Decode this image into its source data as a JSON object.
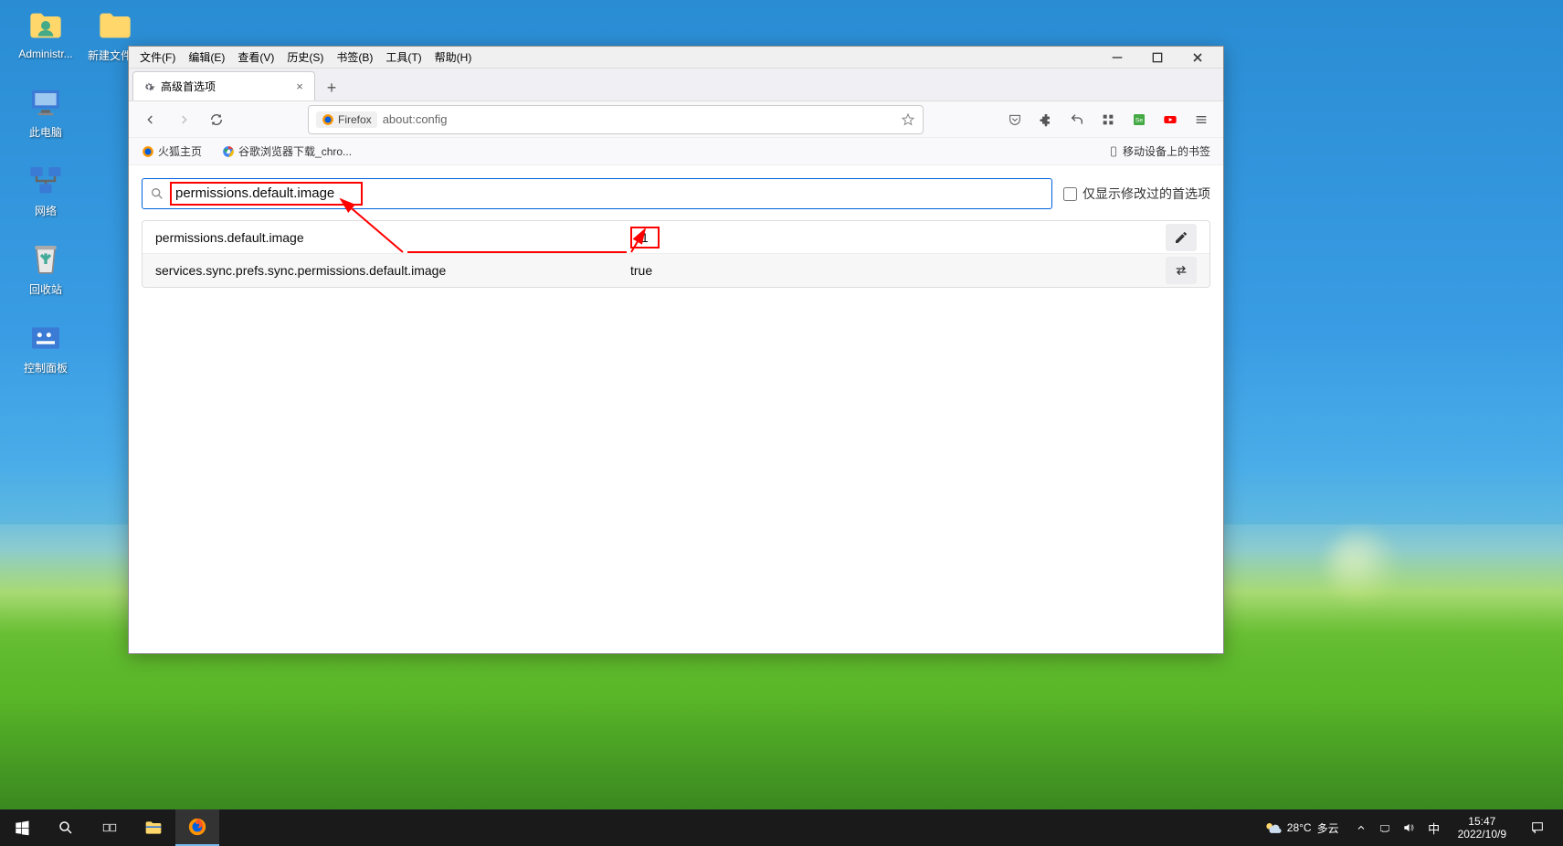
{
  "desktop_icons": {
    "admin": "Administr...",
    "newfolder": "新建文件夹",
    "thispc": "此电脑",
    "network": "网络",
    "recycle": "回收站",
    "control": "控制面板"
  },
  "menubar": {
    "file": "文件(F)",
    "edit": "编辑(E)",
    "view": "查看(V)",
    "history": "历史(S)",
    "bookmarks": "书签(B)",
    "tools": "工具(T)",
    "help": "帮助(H)"
  },
  "tab": {
    "title": "高级首选项"
  },
  "urlbar": {
    "identity": "Firefox",
    "url": "about:config"
  },
  "bookmarks": {
    "firefox_home": "火狐主页",
    "chrome_dl": "谷歌浏览器下载_chro...",
    "mobile": "移动设备上的书签"
  },
  "config": {
    "search_value": "permissions.default.image",
    "modified_only_label": "仅显示修改过的首选项",
    "rows": [
      {
        "name": "permissions.default.image",
        "value": "1",
        "action": "edit",
        "highlight": true
      },
      {
        "name": "services.sync.prefs.sync.permissions.default.image",
        "value": "true",
        "action": "toggle",
        "highlight": false
      }
    ]
  },
  "taskbar": {
    "weather_temp": "28°C",
    "weather_cond": "多云",
    "ime": "中",
    "time": "15:47",
    "date": "2022/10/9"
  }
}
